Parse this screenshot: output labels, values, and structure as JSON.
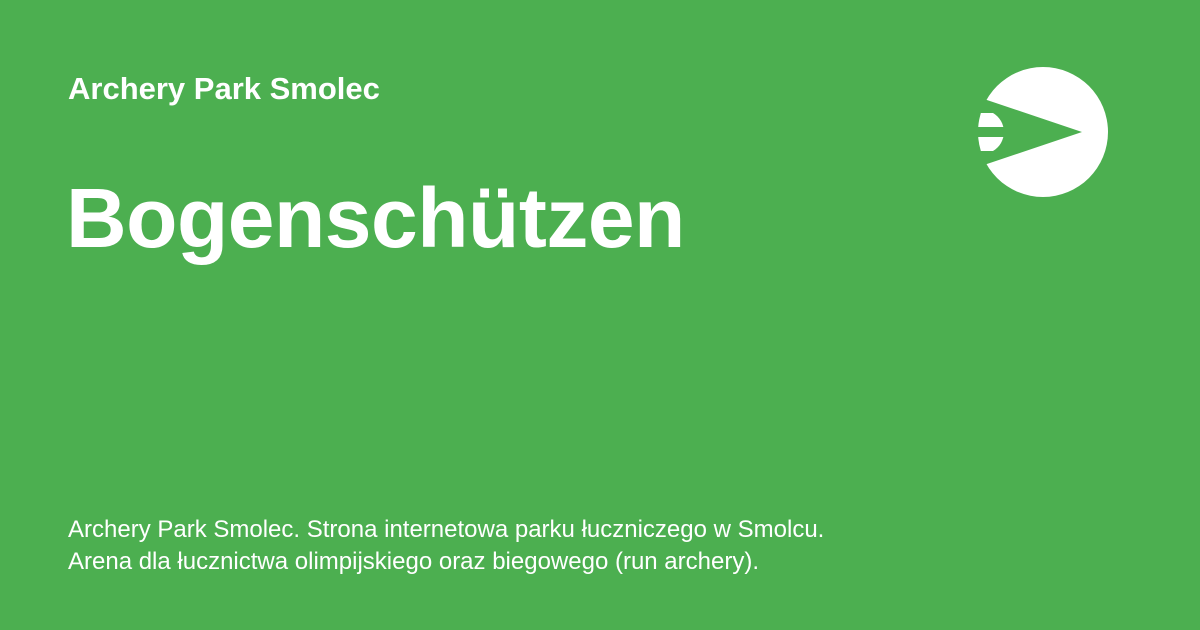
{
  "site": {
    "name": "Archery Park Smolec"
  },
  "page": {
    "title": "Bogenschützen"
  },
  "description": {
    "lines": [
      "Archery Park Smolec. Strona internetowa parku łuczniczego w Smolcu.",
      "Arena dla łucznictwa olimpijskiego oraz biegowego (run archery)."
    ]
  },
  "logo": {
    "icon": "arrow-target-logo-icon"
  },
  "colors": {
    "background": "#4caf50",
    "foreground": "#ffffff"
  }
}
